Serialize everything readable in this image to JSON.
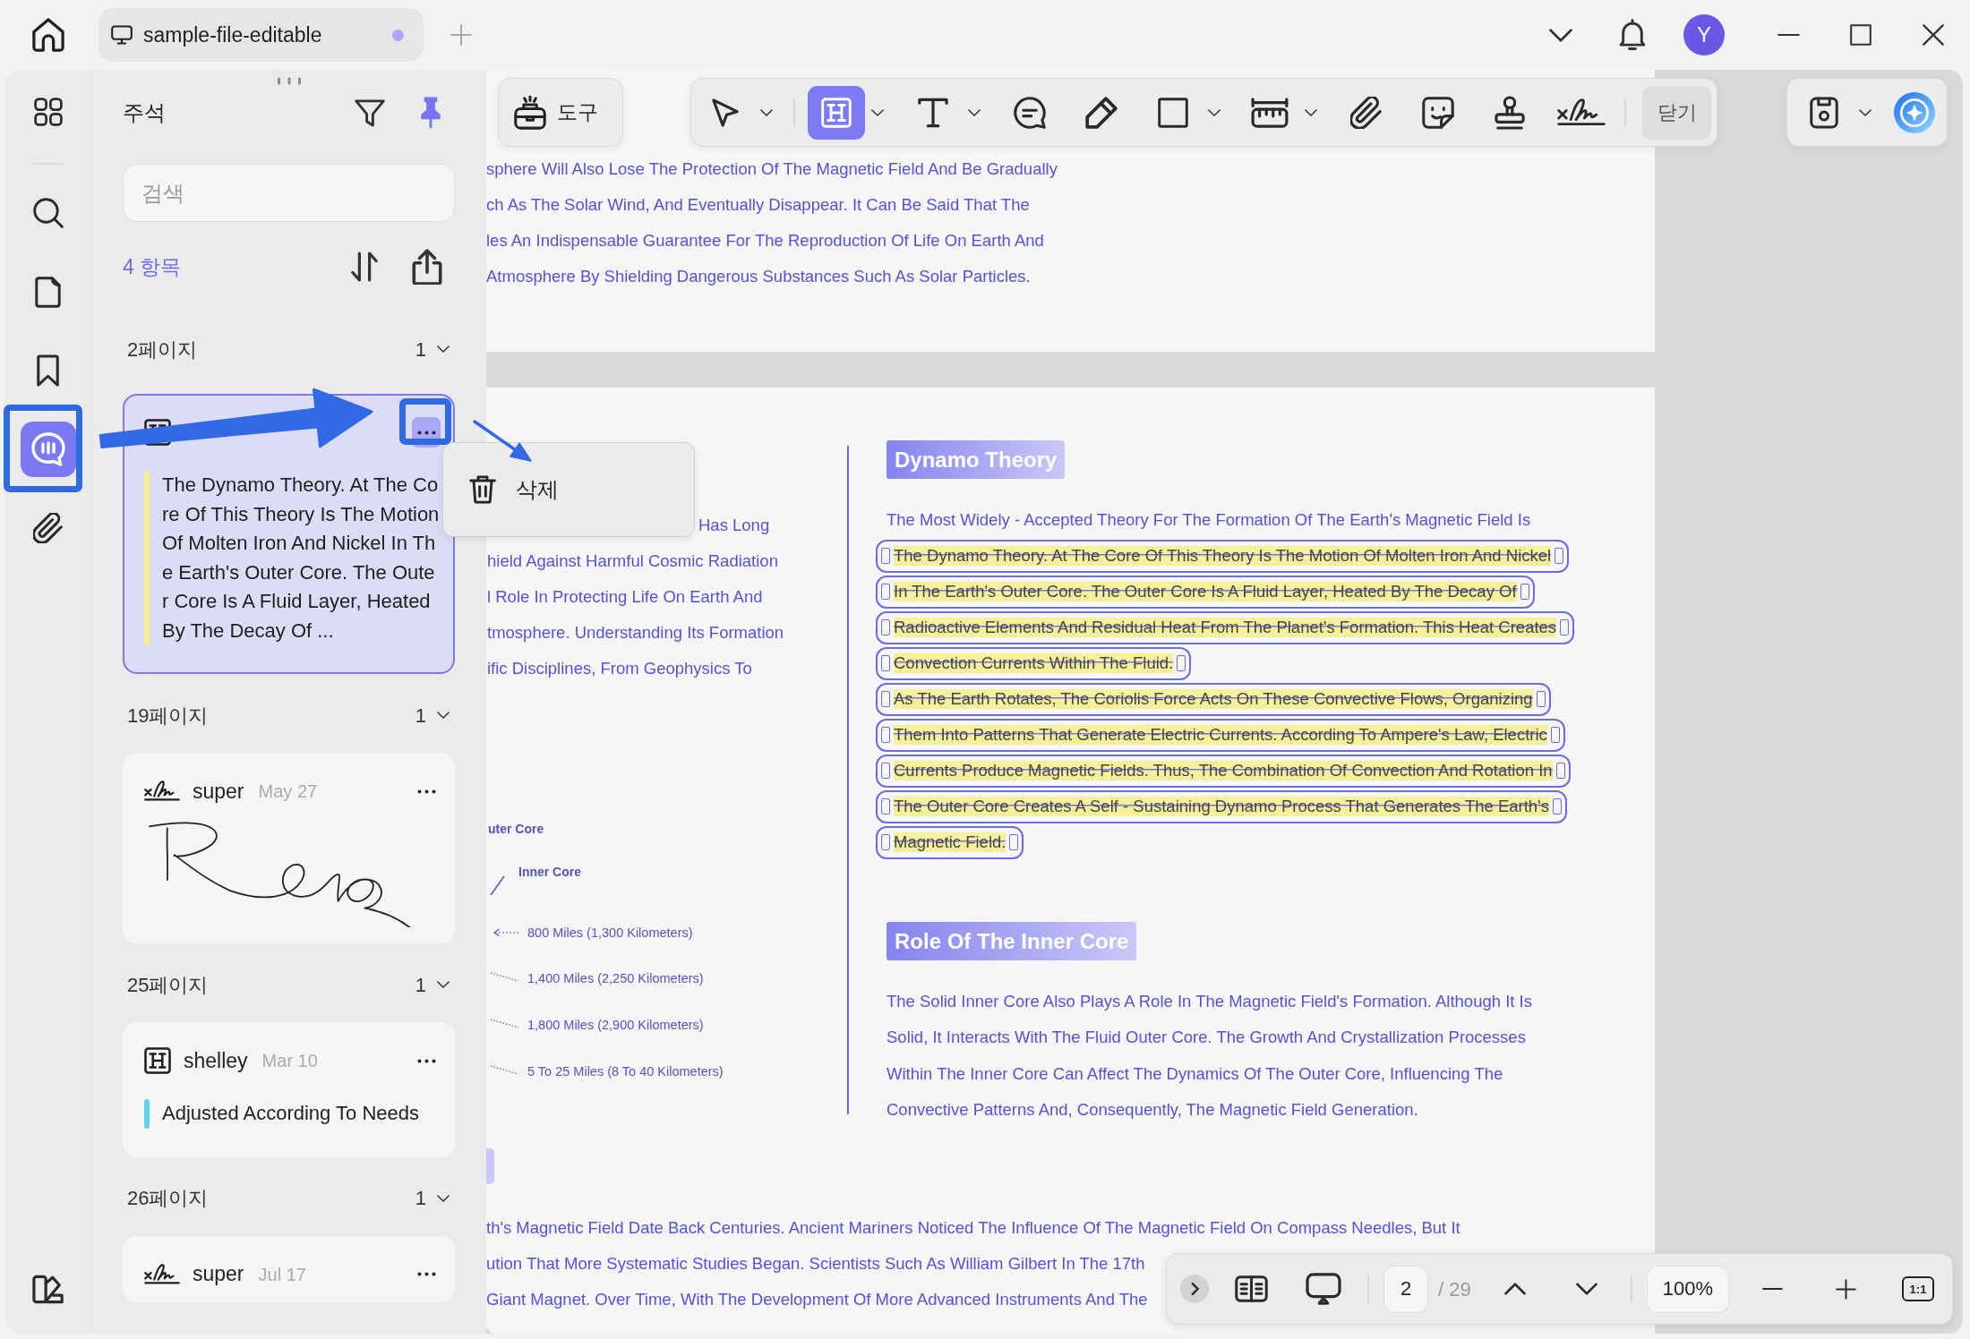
{
  "title_bar": {
    "tab": {
      "title": "sample-file-editable",
      "unsaved": true
    },
    "avatar": "Y"
  },
  "rail": {
    "items": [
      {
        "kind": "thumbnails",
        "selected": false
      },
      {
        "kind": "search",
        "selected": false
      },
      {
        "kind": "pages",
        "selected": false
      },
      {
        "kind": "bookmarks",
        "selected": false
      },
      {
        "kind": "comments",
        "selected": true
      },
      {
        "kind": "attachments",
        "selected": false
      }
    ]
  },
  "annotations_panel": {
    "title": "주석",
    "pinned": true,
    "search": {
      "placeholder": "검색"
    },
    "count": "4 항목",
    "groups": [
      {
        "page": "2페이지",
        "count": "1",
        "expanded": true,
        "cards": [
          {
            "kind": "highlight",
            "selected": true,
            "menu_open": true,
            "color": "#f6f08e",
            "text": "The Dynamo Theory. At The Core Of This Theory Is The Motion Of Molten Iron And Nickel In The Earth's Outer Core. The Outer Core Is A Fluid Layer, Heated By The Decay Of ..."
          }
        ]
      },
      {
        "page": "19페이지",
        "count": "1",
        "expanded": true,
        "cards": [
          {
            "kind": "signature",
            "selected": false,
            "menu_open": false,
            "author": "super",
            "date": "May 27",
            "drawing": true
          }
        ]
      },
      {
        "page": "25페이지",
        "count": "1",
        "expanded": true,
        "cards": [
          {
            "kind": "highlight",
            "selected": false,
            "menu_open": false,
            "author": "shelley",
            "date": "Mar 10",
            "color": "#5dd3f6",
            "text": "Adjusted According To Needs"
          }
        ]
      },
      {
        "page": "26페이지",
        "count": "1",
        "expanded": true,
        "cards": [
          {
            "kind": "signature",
            "selected": false,
            "menu_open": false,
            "author": "super",
            "date": "Jul 17"
          }
        ]
      }
    ],
    "context_menu": {
      "items": [
        {
          "kind": "delete",
          "label": "삭제"
        }
      ]
    }
  },
  "toolbar": {
    "tools_button": "도구",
    "tools": [
      {
        "kind": "select",
        "selected": false,
        "menu": true
      },
      {
        "kind": "highlight",
        "selected": true,
        "menu": true
      },
      {
        "kind": "text",
        "selected": false,
        "menu": true
      },
      {
        "kind": "comment",
        "selected": false,
        "menu": false
      },
      {
        "kind": "pencil",
        "selected": false,
        "menu": false
      },
      {
        "kind": "shape",
        "selected": false,
        "menu": true
      },
      {
        "kind": "measure",
        "selected": false,
        "menu": true
      },
      {
        "kind": "attach",
        "selected": false,
        "menu": false
      },
      {
        "kind": "sticker",
        "selected": false,
        "menu": false
      },
      {
        "kind": "stamp",
        "selected": false,
        "menu": false
      },
      {
        "kind": "signature",
        "selected": false,
        "menu": false
      }
    ],
    "close": "닫기",
    "actions": [
      {
        "kind": "save",
        "menu": true
      },
      {
        "kind": "assistant",
        "menu": false
      }
    ]
  },
  "document": {
    "page_1": {
      "lines": [
        "sphere Will Also Lose The Protection Of The Magnetic Field And Be Gradually",
        "ch As The Solar Wind, And Eventually Disappear. It Can Be Said That The",
        "les An Indispensable Guarantee For The Reproduction Of Life On Earth And",
        "Atmosphere By Shielding Dangerous Substances Such As Solar Particles."
      ]
    },
    "page_2": {
      "left_lines": [
        "Has Long",
        "hield Against Harmful Cosmic Radiation",
        "l Role In Protecting Life On Earth And",
        "tmosphere. Understanding Its Formation",
        "ific Disciplines, From Geophysics To"
      ],
      "diagram_labels": [
        {
          "kind": "layer",
          "text": "uter Core"
        },
        {
          "kind": "layer",
          "text": "Inner Core"
        },
        {
          "kind": "depth",
          "text": "800 Miles (1,300 Kilometers)"
        },
        {
          "kind": "depth",
          "text": "1,400 Miles (2,250 Kilometers)"
        },
        {
          "kind": "depth",
          "text": "1,800 Miles (2,900 Kilometers)"
        },
        {
          "kind": "depth",
          "text": "5 To 25 Miles (8 To 40 Kilometers)"
        }
      ],
      "sections": [
        {
          "heading": "Dynamo Theory",
          "paragraph": "The Most Widely - Accepted Theory For The Formation Of The Earth's Magnetic Field Is",
          "highlight": {
            "selected": true,
            "lines": [
              "The Dynamo Theory. At The Core Of This Theory Is The Motion Of Molten Iron And Nickel",
              "In The Earth's Outer Core. The Outer Core Is A Fluid Layer, Heated By The Decay Of",
              "Radioactive Elements And Residual Heat From The Planet's Formation. This Heat Creates",
              "Convection Currents Within The Fluid.",
              "As The Earth Rotates, The Coriolis Force Acts On These Convective Flows, Organizing",
              "Them Into Patterns That Generate Electric Currents. According To Ampere's Law, Electric",
              "Currents Produce Magnetic Fields. Thus, The Combination Of Convection And Rotation In",
              "The Outer Core Creates A Self - Sustaining Dynamo Process That Generates The Earth's",
              "Magnetic Field."
            ]
          }
        },
        {
          "heading": "Role Of The Inner Core",
          "paragraph": "The Solid Inner Core Also Plays A Role In The Magnetic Field's Formation. Although It Is Solid, It Interacts With The Fluid Outer Core. The Growth And Crystallization Processes Within The Inner Core Can Affect The Dynamics Of The Outer Core, Influencing The Convective Patterns And, Consequently, The Magnetic Field Generation."
        }
      ],
      "bottom_lines": [
        "th's Magnetic Field Date Back Centuries. Ancient Mariners Noticed The Influence Of The Magnetic Field On Compass Needles, But It",
        "ution That More Systematic Studies Began. Scientists Such As William Gilbert In The 17th",
        "Giant Magnet. Over Time, With The Development Of More Advanced Instruments And The"
      ]
    }
  },
  "page_nav": {
    "page": "2",
    "total": "/ 29",
    "zoom": "100%",
    "actual_size": "1:1"
  }
}
